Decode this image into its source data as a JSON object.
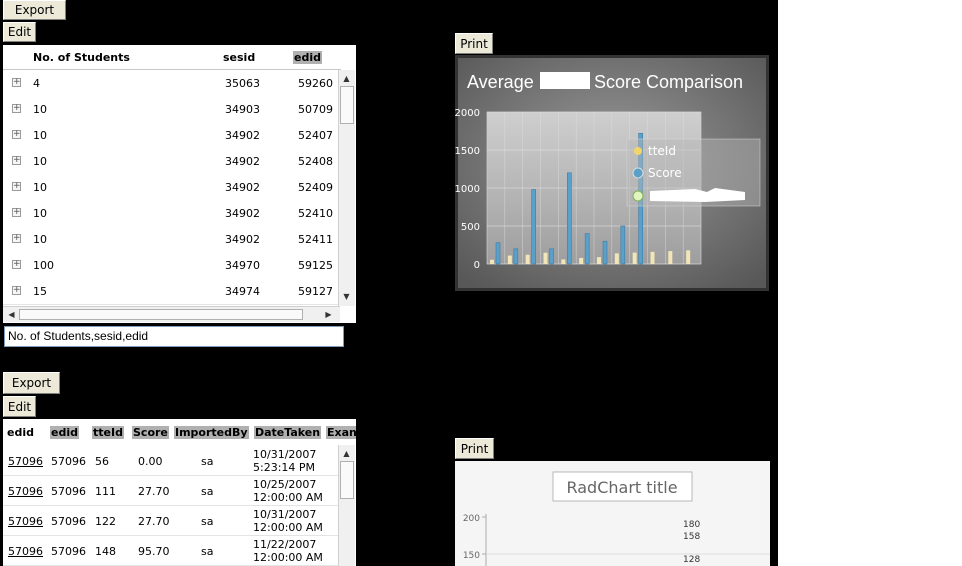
{
  "export_label": "Export",
  "edit_label": "Edit",
  "print_label": "Print",
  "grid1": {
    "headers": [
      "No. of Students",
      "sesid",
      "edid"
    ],
    "rows": [
      [
        "4",
        "35063",
        "59260"
      ],
      [
        "10",
        "34903",
        "50709"
      ],
      [
        "10",
        "34902",
        "52407"
      ],
      [
        "10",
        "34902",
        "52408"
      ],
      [
        "10",
        "34902",
        "52409"
      ],
      [
        "10",
        "34902",
        "52410"
      ],
      [
        "10",
        "34902",
        "52411"
      ],
      [
        "100",
        "34970",
        "59125"
      ],
      [
        "15",
        "34974",
        "59127"
      ]
    ],
    "expander_icon": "+",
    "column_list": "No. of Students,sesid,edid"
  },
  "grid2": {
    "headers": [
      "edid",
      "edid",
      "tteId",
      "Score",
      "ImportedBy",
      "DateTaken",
      "Exan"
    ],
    "rows": [
      {
        "link": "57096",
        "edid": "57096",
        "tteid": "56",
        "score": "0.00",
        "by": "sa",
        "date1": "10/31/2007",
        "date2": "5:23:14 PM"
      },
      {
        "link": "57096",
        "edid": "57096",
        "tteid": "111",
        "score": "27.70",
        "by": "sa",
        "date1": "10/25/2007",
        "date2": "12:00:00 AM"
      },
      {
        "link": "57096",
        "edid": "57096",
        "tteid": "122",
        "score": "27.70",
        "by": "sa",
        "date1": "10/31/2007",
        "date2": "12:00:00 AM"
      },
      {
        "link": "57096",
        "edid": "57096",
        "tteid": "148",
        "score": "95.70",
        "by": "sa",
        "date1": "11/22/2007",
        "date2": "12:00:00 AM"
      }
    ]
  },
  "chart_data": [
    {
      "type": "bar",
      "title_left": "Average",
      "title_right": "Score Comparison",
      "y_ticks": [
        "2000",
        "1500",
        "1000",
        "500",
        "0"
      ],
      "ylim": [
        0,
        2000
      ],
      "legend": [
        "tteId",
        "Score"
      ],
      "series": [
        {
          "name": "tteId",
          "color": "#f2e6b8",
          "values": [
            56,
            111,
            122,
            148,
            60,
            80,
            90,
            140,
            150,
            160,
            170,
            180
          ]
        },
        {
          "name": "Score",
          "color": "#5aa0c8",
          "values": [
            280,
            200,
            980,
            200,
            1200,
            400,
            300,
            500,
            1720,
            0,
            0,
            0
          ]
        }
      ]
    },
    {
      "type": "bar",
      "title": "RadChart title",
      "y_ticks": [
        "200",
        "150"
      ],
      "labels": [
        "180",
        "158",
        "128"
      ]
    }
  ]
}
